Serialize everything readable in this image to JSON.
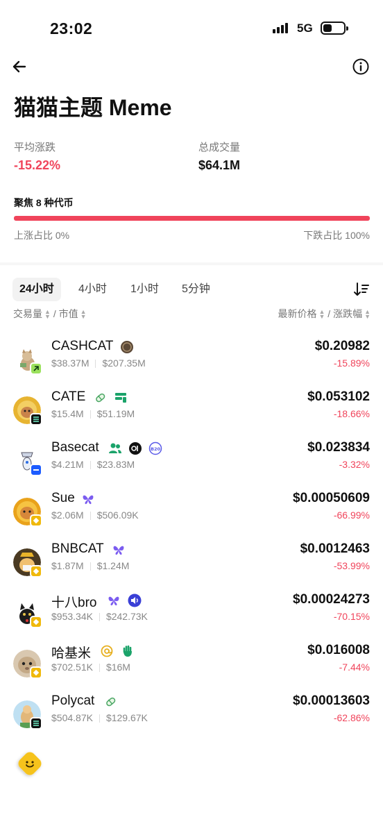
{
  "status_bar": {
    "time": "23:02",
    "network": "5G",
    "battery_level": 0.35
  },
  "header": {
    "back_icon": "arrow-left-icon",
    "info_icon": "info-circle-icon"
  },
  "title": "猫猫主题 Meme",
  "stats": {
    "avg_change_label": "平均涨跌",
    "avg_change_value": "-15.22%",
    "volume_label": "总成交量",
    "volume_value": "$64.1M"
  },
  "focus": {
    "label": "聚焦 8 种代币",
    "up_ratio_label": "上涨占比 0%",
    "down_ratio_label": "下跌占比 100%",
    "up_fraction": 0,
    "down_fraction": 1
  },
  "tabs": [
    {
      "label": "24小时",
      "active": true
    },
    {
      "label": "4小时",
      "active": false
    },
    {
      "label": "1小时",
      "active": false
    },
    {
      "label": "5分钟",
      "active": false
    }
  ],
  "columns": {
    "volume": "交易量",
    "separator": "/",
    "market_cap": "市值",
    "price": "最新价格",
    "change": "涨跌幅"
  },
  "tokens": [
    {
      "name": "CASHCAT",
      "volume": "$38.37M",
      "market_cap": "$207.35M",
      "price": "$0.20982",
      "change": "-15.89%",
      "chain": "solana",
      "badges": [
        "coin-icon"
      ]
    },
    {
      "name": "CATE",
      "volume": "$15.4M",
      "market_cap": "$51.19M",
      "price": "$0.053102",
      "change": "-18.66%",
      "chain": "solana",
      "badges": [
        "pill-icon",
        "dex-icon"
      ]
    },
    {
      "name": "Basecat",
      "volume": "$4.21M",
      "market_cap": "$23.83M",
      "price": "$0.023834",
      "change": "-3.32%",
      "chain": "base",
      "badges": [
        "community-icon",
        "o1-icon",
        "b20-icon"
      ]
    },
    {
      "name": "Sue",
      "volume": "$2.06M",
      "market_cap": "$506.09K",
      "price": "$0.00050609",
      "change": "-66.99%",
      "chain": "bnb",
      "badges": [
        "butterfly-icon"
      ]
    },
    {
      "name": "BNBCAT",
      "volume": "$1.87M",
      "market_cap": "$1.24M",
      "price": "$0.0012463",
      "change": "-53.99%",
      "chain": "bnb",
      "badges": [
        "butterfly-icon"
      ]
    },
    {
      "name": "十八bro",
      "volume": "$953.34K",
      "market_cap": "$242.73K",
      "price": "$0.00024273",
      "change": "-70.15%",
      "chain": "bnb",
      "badges": [
        "butterfly-icon",
        "sound-icon"
      ]
    },
    {
      "name": "哈基米",
      "volume": "$702.51K",
      "market_cap": "$16M",
      "price": "$0.016008",
      "change": "-7.44%",
      "chain": "bnb",
      "badges": [
        "at-icon",
        "wave-hand-icon"
      ]
    },
    {
      "name": "Polycat",
      "volume": "$504.87K",
      "market_cap": "$129.67K",
      "price": "$0.00013603",
      "change": "-62.86%",
      "chain": "solana",
      "badges": [
        "pill-icon"
      ]
    }
  ],
  "fab": {
    "icon": "smiley-diamond-icon"
  },
  "colors": {
    "down": "#f0445b",
    "up": "#22b07d"
  }
}
